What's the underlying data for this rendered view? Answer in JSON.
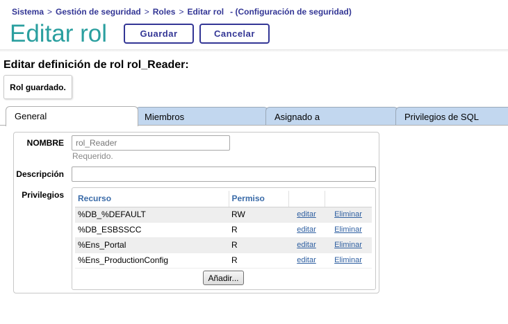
{
  "breadcrumb": {
    "items": [
      "Sistema",
      "Gestión de seguridad",
      "Roles",
      "Editar rol"
    ],
    "separator": ">",
    "context": "- (Configuración de seguridad)"
  },
  "header": {
    "title": "Editar rol",
    "save_label": "Guardar",
    "cancel_label": "Cancelar"
  },
  "section_title": "Editar definición de rol rol_Reader:",
  "status_message": "Rol guardado.",
  "tabs": [
    {
      "label": "General",
      "active": true
    },
    {
      "label": "Miembros",
      "active": false
    },
    {
      "label": "Asignado a",
      "active": false
    },
    {
      "label": "Privilegios de SQL",
      "active": false
    }
  ],
  "form": {
    "name_label": "NOMBRE",
    "name_value": "rol_Reader",
    "name_hint": "Requerido.",
    "description_label": "Descripción",
    "description_value": "",
    "privileges_label": "Privilegios"
  },
  "privileges": {
    "headers": [
      "Recurso",
      "Permiso",
      "",
      ""
    ],
    "rows": [
      {
        "resource": "%DB_%DEFAULT",
        "permission": "RW",
        "edit": "editar",
        "delete": "Eliminar"
      },
      {
        "resource": "%DB_ESBSSCC",
        "permission": "R",
        "edit": "editar",
        "delete": "Eliminar"
      },
      {
        "resource": "%Ens_Portal",
        "permission": "R",
        "edit": "editar",
        "delete": "Eliminar"
      },
      {
        "resource": "%Ens_ProductionConfig",
        "permission": "R",
        "edit": "editar",
        "delete": "Eliminar"
      }
    ],
    "add_label": "Añadir..."
  },
  "colors": {
    "accent": "#333695",
    "title": "#2a9f9f",
    "tab_inactive": "#c2d7ef",
    "link": "#2d5ea0"
  }
}
